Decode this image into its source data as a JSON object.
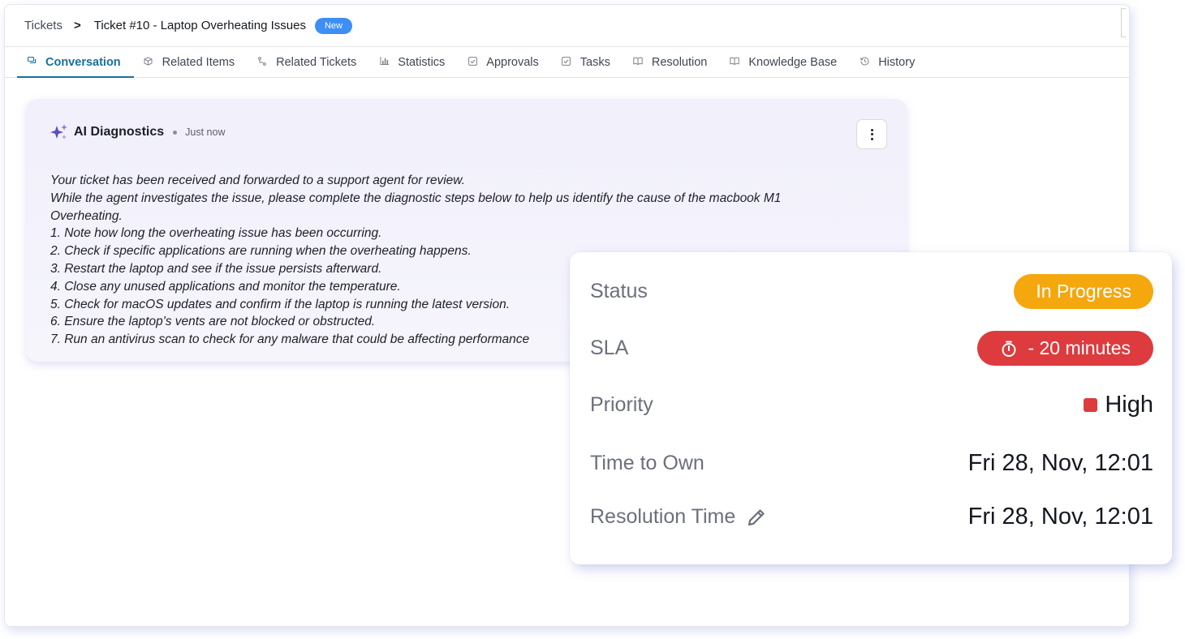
{
  "breadcrumb": {
    "root": "Tickets",
    "separator": ">",
    "current": "Ticket #10 - Laptop Overheating Issues",
    "badge": "New"
  },
  "tabs": [
    {
      "label": "Conversation",
      "icon": "chat-icon",
      "active": true
    },
    {
      "label": "Related Items",
      "icon": "cube-icon",
      "active": false
    },
    {
      "label": "Related Tickets",
      "icon": "link-icon",
      "active": false
    },
    {
      "label": "Statistics",
      "icon": "bar-chart-icon",
      "active": false
    },
    {
      "label": "Approvals",
      "icon": "check-square-icon",
      "active": false
    },
    {
      "label": "Tasks",
      "icon": "check-square-icon",
      "active": false
    },
    {
      "label": "Resolution",
      "icon": "book-icon",
      "active": false
    },
    {
      "label": "Knowledge Base",
      "icon": "book-open-icon",
      "active": false
    },
    {
      "label": "History",
      "icon": "history-icon",
      "active": false
    }
  ],
  "message": {
    "author": "AI Diagnostics",
    "time": "Just now",
    "author_icon": "sparkle-icon",
    "lines": [
      "Your ticket has been received and forwarded to a support agent for review.",
      "While the agent investigates the issue, please complete the diagnostic steps below to help us identify the cause of the macbook M1",
      "Overheating.",
      "1. Note how long the overheating issue has been occurring.",
      "2. Check if specific applications are running when the overheating happens.",
      "3. Restart the laptop and see if the issue persists afterward.",
      "4. Close any unused applications and monitor the temperature.",
      "5. Check for macOS updates and confirm if the laptop is running the latest version.",
      "6. Ensure the laptop's vents are not blocked or obstructed.",
      "7. Run an antivirus scan to check for any malware that could be affecting performance"
    ]
  },
  "details": {
    "status_label": "Status",
    "status_value": "In Progress",
    "sla_label": "SLA",
    "sla_value": "- 20 minutes",
    "priority_label": "Priority",
    "priority_value": "High",
    "time_to_own_label": "Time to Own",
    "time_to_own_value": "Fri 28, Nov, 12:01",
    "resolution_time_label": "Resolution Time",
    "resolution_time_value": "Fri 28, Nov, 12:01"
  },
  "colors": {
    "accent": "#176f9e",
    "badge_new": "#3d8ff5",
    "status_in_progress": "#f5a70e",
    "sla_overdue": "#dd3b3e",
    "priority_high": "#dd3b3e"
  }
}
